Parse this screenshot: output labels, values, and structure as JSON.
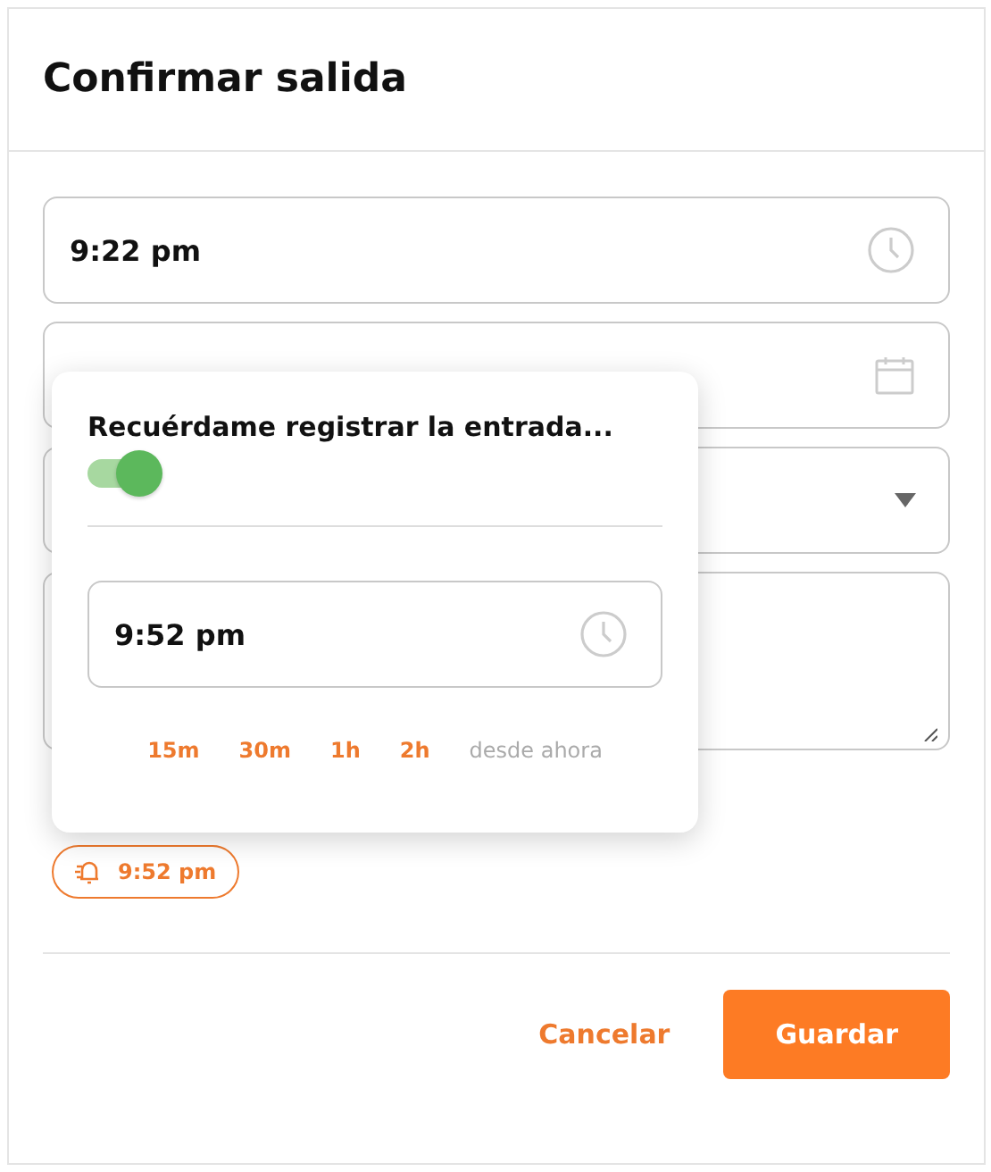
{
  "dialog": {
    "title": "Confirmar salida"
  },
  "time_field": {
    "value": "9:22 pm"
  },
  "select_field": {
    "expanded": false
  },
  "reminder_popover": {
    "label": "Recuérdame registrar la entrada...",
    "on": true,
    "time_value": "9:52 pm",
    "presets": [
      {
        "label": "15m",
        "kind": "option"
      },
      {
        "label": "30m",
        "kind": "option"
      },
      {
        "label": "1h",
        "kind": "option"
      },
      {
        "label": "2h",
        "kind": "option"
      },
      {
        "label": "desde ahora",
        "kind": "hint"
      }
    ]
  },
  "reminder_chip": {
    "label": "9:52 pm"
  },
  "buttons": [
    {
      "label": "Cancelar",
      "kind": "text"
    },
    {
      "label": "Guardar",
      "kind": "primary"
    }
  ]
}
